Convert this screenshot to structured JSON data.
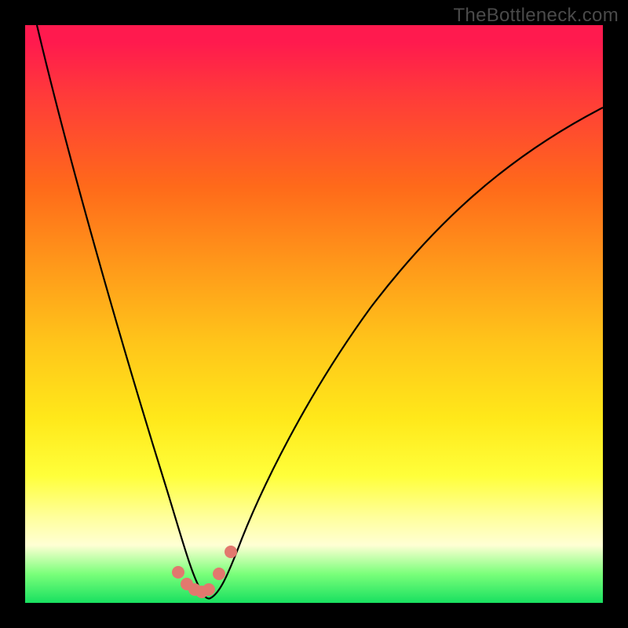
{
  "watermark": {
    "text": "TheBottleneck.com"
  },
  "chart_data": {
    "type": "line",
    "title": "",
    "xlabel": "",
    "ylabel": "",
    "xlim": [
      0,
      100
    ],
    "ylim": [
      0,
      100
    ],
    "grid": false,
    "series": [
      {
        "name": "curve",
        "x": [
          2,
          5,
          10,
          15,
          20,
          24,
          27,
          29,
          30.5,
          32,
          35,
          40,
          50,
          60,
          70,
          80,
          90,
          98
        ],
        "y": [
          100,
          84,
          62,
          42,
          25,
          12,
          5,
          1,
          0,
          1,
          7,
          18,
          40,
          55,
          66,
          75,
          82,
          86
        ]
      }
    ],
    "markers": [
      {
        "x_pct": 26.5,
        "y_pct_from_top": 94.7
      },
      {
        "x_pct": 28.0,
        "y_pct_from_top": 96.7
      },
      {
        "x_pct": 29.3,
        "y_pct_from_top": 97.6
      },
      {
        "x_pct": 30.5,
        "y_pct_from_top": 98.0
      },
      {
        "x_pct": 31.8,
        "y_pct_from_top": 97.6
      },
      {
        "x_pct": 33.6,
        "y_pct_from_top": 95.0
      },
      {
        "x_pct": 35.6,
        "y_pct_from_top": 91.2
      }
    ],
    "gradient_stops_pct_from_top": {
      "red": 0,
      "orange": 40,
      "yellow": 75,
      "pale": 90,
      "green": 100
    }
  }
}
